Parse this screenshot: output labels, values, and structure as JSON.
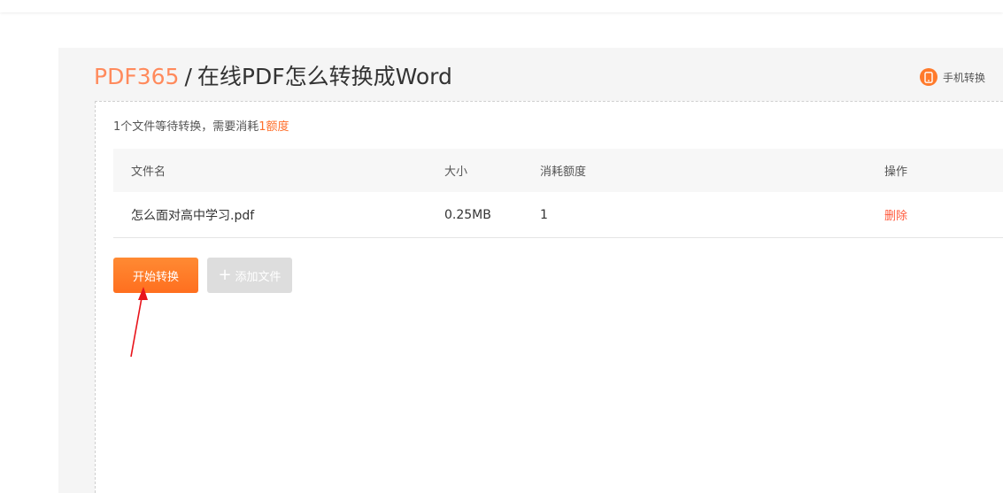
{
  "header": {
    "brand": "PDF365",
    "separator": "/",
    "title": "在线PDF怎么转换成Word",
    "mobile_label": "手机转换"
  },
  "summary": {
    "prefix": "1个文件等待转换，需要消耗",
    "amount": "1额度"
  },
  "table": {
    "columns": [
      "文件名",
      "大小",
      "消耗额度",
      "操作"
    ],
    "rows": [
      {
        "name": "怎么面对高中学习.pdf",
        "size": "0.25MB",
        "cost": "1",
        "action": "删除"
      }
    ]
  },
  "buttons": {
    "start": "开始转换",
    "add": "添加文件"
  },
  "colors": {
    "brand": "#ff8a5c",
    "accent": "#ff6f2b",
    "annotation_arrow": "#e8141b"
  }
}
